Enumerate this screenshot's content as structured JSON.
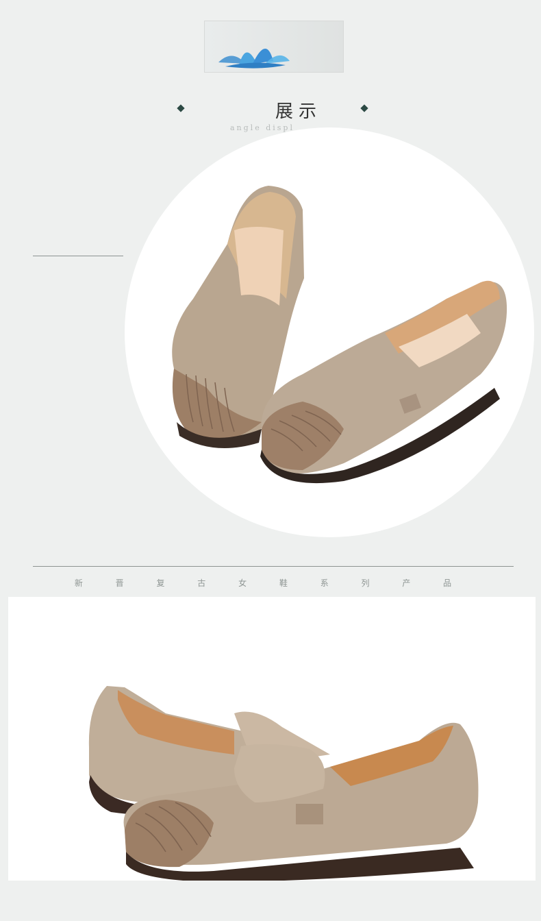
{
  "header": {
    "title": "展示",
    "subtitle": "angle displ"
  },
  "footer_caption": "新 晋 复 古 女 鞋 系 列 产 品",
  "colors": {
    "background": "#eef0ef",
    "accent": "#2c4a44",
    "shoe_leather": "#bda994",
    "shoe_toe": "#9e8068",
    "lining": "#d8a779"
  }
}
